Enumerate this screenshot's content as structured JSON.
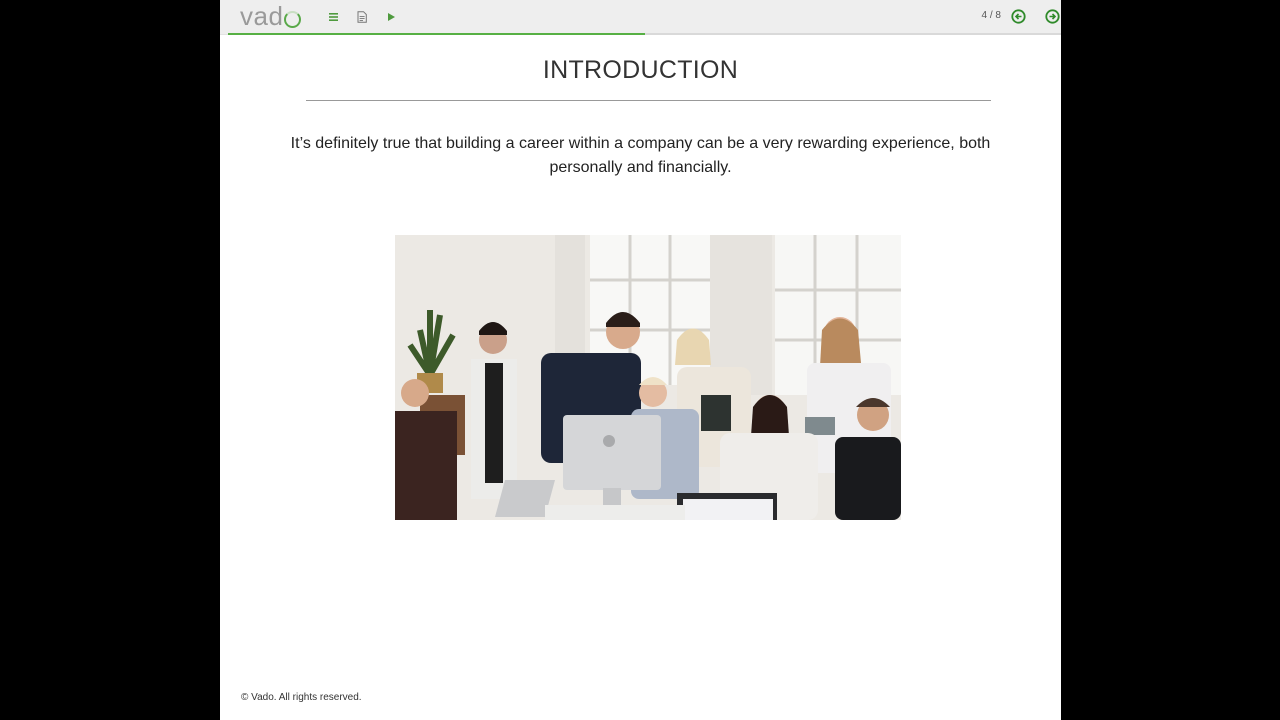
{
  "topbar": {
    "logo_text": "vad",
    "menu_icon": "menu-icon",
    "doc_icon": "document-icon",
    "play_icon": "play-icon",
    "page_counter": "4 / 8",
    "prev_icon": "arrow-left-circle-icon",
    "next_icon": "arrow-right-circle-icon",
    "progress": 0.5,
    "accent_color": "#57b044"
  },
  "slide": {
    "title": "INTRODUCTION",
    "body": "It’s definitely true that building a career within a company can be a very rewarding experience, both personally and financially."
  },
  "footer": {
    "copyright": "© Vado. All rights reserved."
  }
}
